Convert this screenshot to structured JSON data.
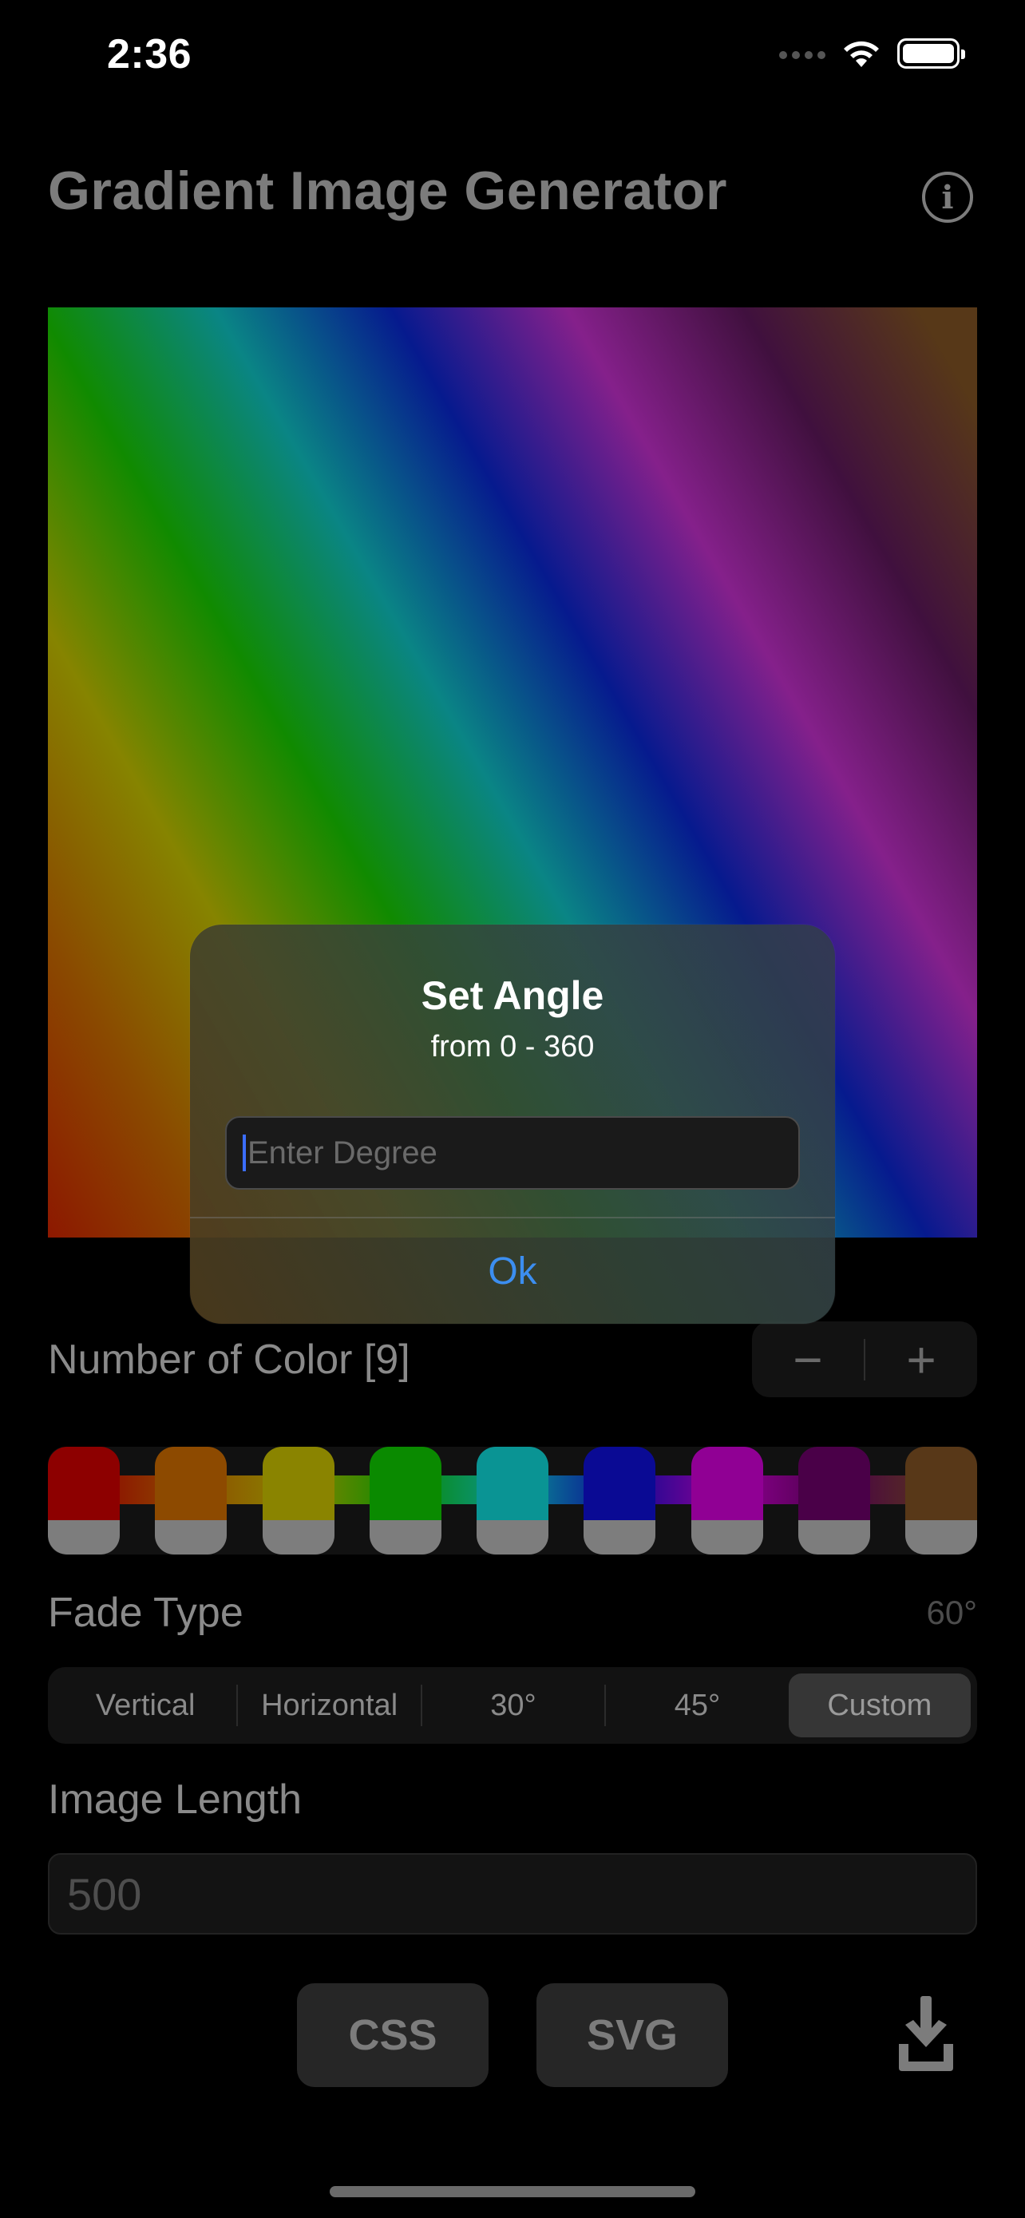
{
  "status_bar": {
    "time": "2:36"
  },
  "header": {
    "title": "Gradient Image Generator",
    "info_icon": "info-circle-icon"
  },
  "colors": {
    "accent": "#3c8ef0",
    "swatches": [
      "#8d0000",
      "#8d4a00",
      "#8a8400",
      "#0a8a00",
      "#0a9494",
      "#0a0a94",
      "#900094",
      "#4a0048",
      "#583818"
    ]
  },
  "controls": {
    "number_of_color_label": "Number of Color [9]",
    "stepper_minus": "−",
    "stepper_plus": "+",
    "fade_type_label": "Fade Type",
    "fade_angle_value": "60°",
    "fade_options": [
      "Vertical",
      "Horizontal",
      "30°",
      "45°",
      "Custom"
    ],
    "fade_selected": "Custom",
    "image_length_label": "Image Length",
    "image_length_placeholder": "500",
    "css_button": "CSS",
    "svg_button": "SVG",
    "download_icon": "download-icon"
  },
  "alert": {
    "title": "Set Angle",
    "message": "from 0 - 360",
    "input_placeholder": "Enter Degree",
    "ok_label": "Ok"
  }
}
